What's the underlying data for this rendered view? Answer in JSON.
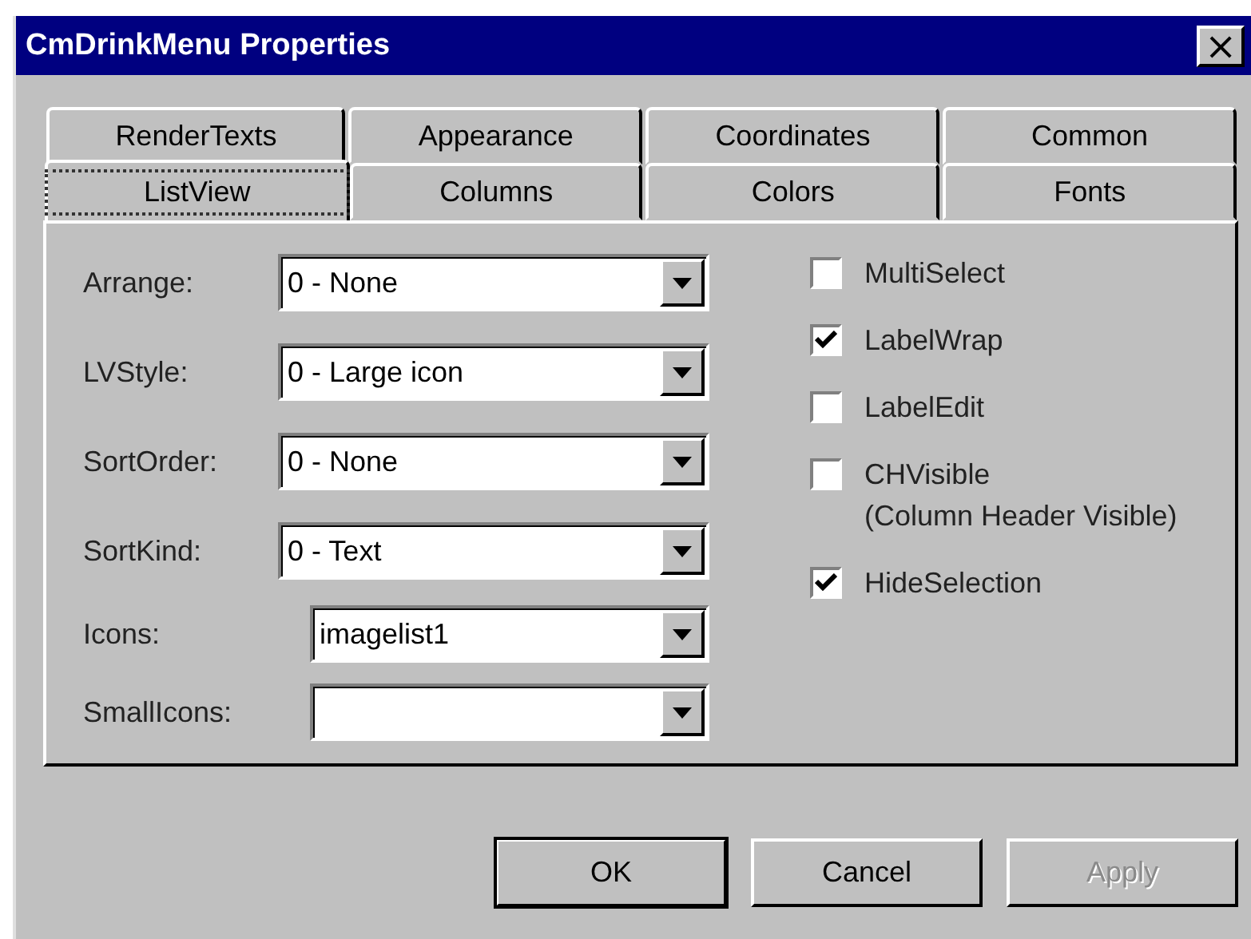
{
  "window": {
    "title": "CmDrinkMenu Properties",
    "close": "×"
  },
  "tab_rows": [
    {
      "tabs": [
        {
          "label": "RenderTexts",
          "selected": false
        },
        {
          "label": "Appearance",
          "selected": false
        },
        {
          "label": "Coordinates",
          "selected": false
        },
        {
          "label": "Common",
          "selected": false
        }
      ]
    },
    {
      "tabs": [
        {
          "label": "ListView",
          "selected": true
        },
        {
          "label": "Columns",
          "selected": false
        },
        {
          "label": "Colors",
          "selected": false
        },
        {
          "label": "Fonts",
          "selected": false
        }
      ]
    }
  ],
  "fields": [
    {
      "label": "Arrange:",
      "value": "0 - None",
      "kind": "list"
    },
    {
      "label": "LVStyle:",
      "value": "0 - Large icon",
      "kind": "list"
    },
    {
      "label": "SortOrder:",
      "value": "0 - None",
      "kind": "list"
    },
    {
      "label": "SortKind:",
      "value": "0 - Text",
      "kind": "list"
    },
    {
      "label": "Icons:",
      "value": "imagelist1",
      "kind": "combo"
    },
    {
      "label": "SmallIcons:",
      "kind": "combo"
    }
  ],
  "options": [
    {
      "label": "MultiSelect",
      "checked": false
    },
    {
      "label": "LabelWrap",
      "checked": true
    },
    {
      "label": "LabelEdit",
      "checked": false
    },
    {
      "label": "CHVisible",
      "note": "(Column Header Visible)",
      "checked": false
    },
    {
      "label": "HideSelection",
      "checked": true
    }
  ],
  "buttons": [
    {
      "label": "OK",
      "default": true,
      "disabled": false
    },
    {
      "label": "Cancel",
      "default": false,
      "disabled": false
    },
    {
      "label": "Apply",
      "default": false,
      "disabled": true
    }
  ]
}
